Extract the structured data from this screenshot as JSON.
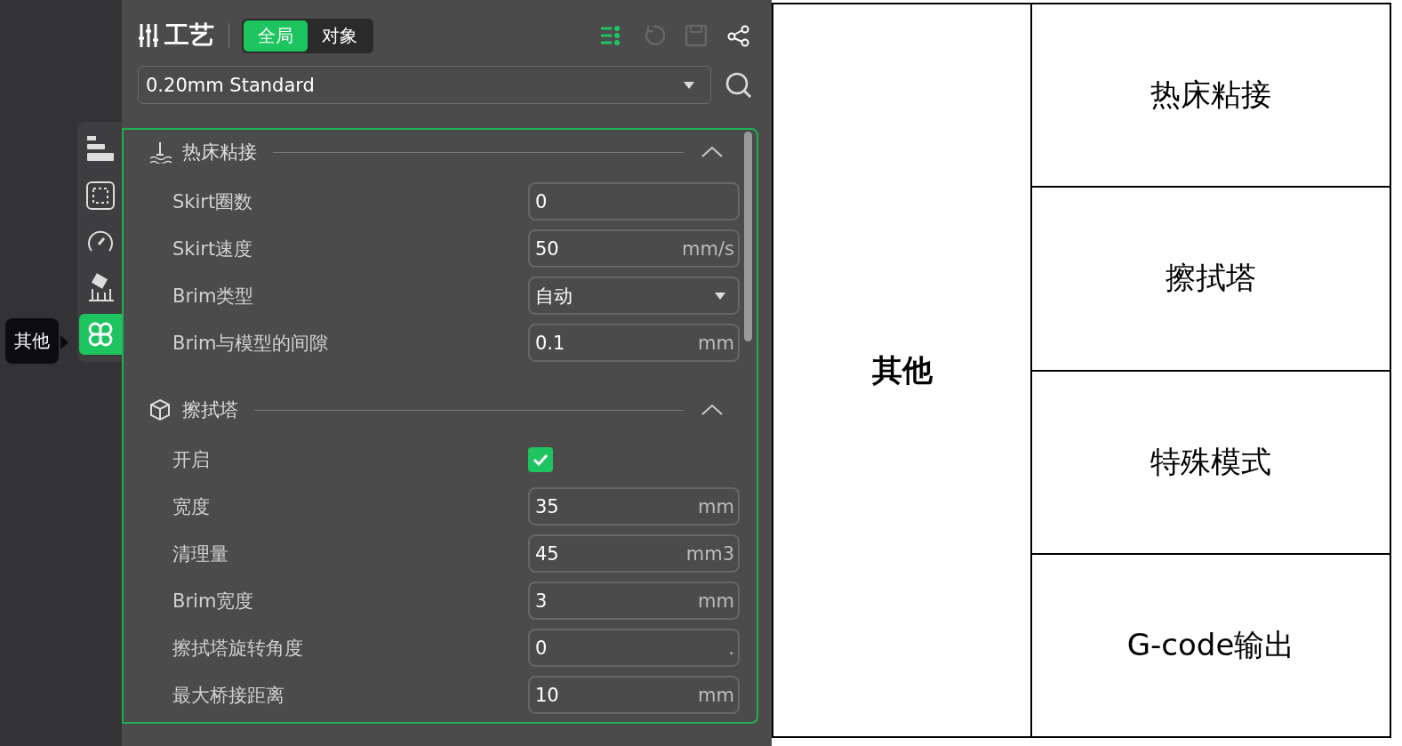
{
  "panel": {
    "title": "工艺",
    "scope_tabs": [
      {
        "label": "全局",
        "selected": true
      },
      {
        "label": "对象",
        "selected": false
      }
    ],
    "preset": {
      "value": "0.20mm Standard"
    },
    "side_tabs": [
      {
        "kind": "layers",
        "selected": false
      },
      {
        "kind": "frame",
        "selected": false
      },
      {
        "kind": "gauge",
        "selected": false
      },
      {
        "kind": "support",
        "selected": false
      },
      {
        "kind": "clover",
        "selected": true
      }
    ],
    "tooltip": "其他",
    "sections": [
      {
        "kind": "bed",
        "title": "热床粘接",
        "expanded": true,
        "rows": [
          {
            "kind": "number",
            "label": "Skirt圈数",
            "value": "0"
          },
          {
            "kind": "number",
            "label": "Skirt速度",
            "value": "50",
            "unit": "mm/s"
          },
          {
            "kind": "select",
            "label": "Brim类型",
            "value": "自动"
          },
          {
            "kind": "number",
            "label": "Brim与模型的间隙",
            "value": "0.1",
            "unit": "mm"
          }
        ]
      },
      {
        "kind": "cube",
        "title": "擦拭塔",
        "expanded": true,
        "rows": [
          {
            "kind": "checkbox",
            "label": "开启",
            "checked": true
          },
          {
            "kind": "number",
            "label": "宽度",
            "value": "35",
            "unit": "mm"
          },
          {
            "kind": "number",
            "label": "清理量",
            "value": "45",
            "unit": "mm3"
          },
          {
            "kind": "number",
            "label": "Brim宽度",
            "value": "3",
            "unit": "mm"
          },
          {
            "kind": "number",
            "label": "擦拭塔旋转角度",
            "value": "0",
            "unit": "."
          },
          {
            "kind": "number",
            "label": "最大桥接距离",
            "value": "10",
            "unit": "mm"
          }
        ]
      }
    ]
  },
  "table": {
    "left": "其他",
    "rows": [
      "热床粘接",
      "擦拭塔",
      "特殊模式",
      "G-code输出"
    ]
  }
}
